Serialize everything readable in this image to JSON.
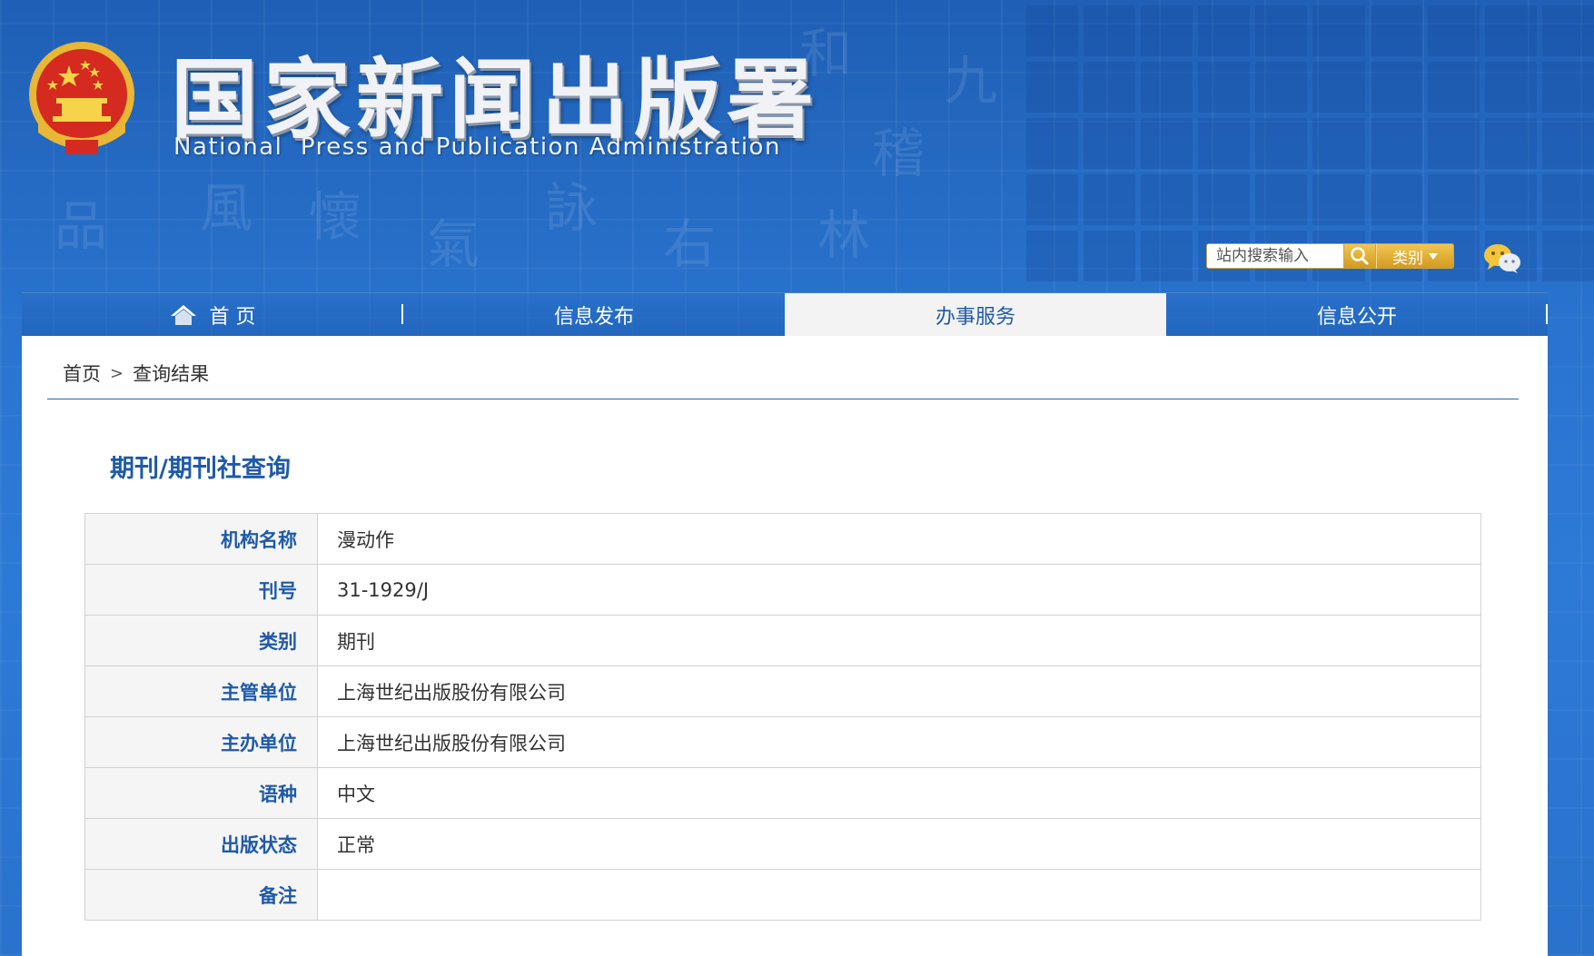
{
  "header": {
    "title": "国家新闻出版署",
    "subtitle": "National  Press and Publication Administration"
  },
  "search": {
    "placeholder": "站内搜索输入",
    "category_label": "类别"
  },
  "nav": {
    "items": [
      {
        "label": "首 页",
        "icon": "home-icon"
      },
      {
        "label": "信息发布"
      },
      {
        "label": "办事服务",
        "active": true
      },
      {
        "label": "信息公开"
      }
    ]
  },
  "breadcrumb": {
    "home": "首页",
    "separator": ">",
    "current": "查询结果"
  },
  "section": {
    "title": "期刊/期刊社查询"
  },
  "record": {
    "rows": [
      {
        "label": "机构名称",
        "value": "漫动作"
      },
      {
        "label": "刊号",
        "value": "31-1929/J"
      },
      {
        "label": "类别",
        "value": "期刊"
      },
      {
        "label": "主管单位",
        "value": "上海世纪出版股份有限公司"
      },
      {
        "label": "主办单位",
        "value": "上海世纪出版股份有限公司"
      },
      {
        "label": "语种",
        "value": "中文"
      },
      {
        "label": "出版状态",
        "value": "正常"
      },
      {
        "label": "备注",
        "value": ""
      }
    ]
  },
  "colors": {
    "brand_blue": "#1f5aa8",
    "search_gold": "#d49a1e",
    "background_blue": "#2a74cf"
  }
}
